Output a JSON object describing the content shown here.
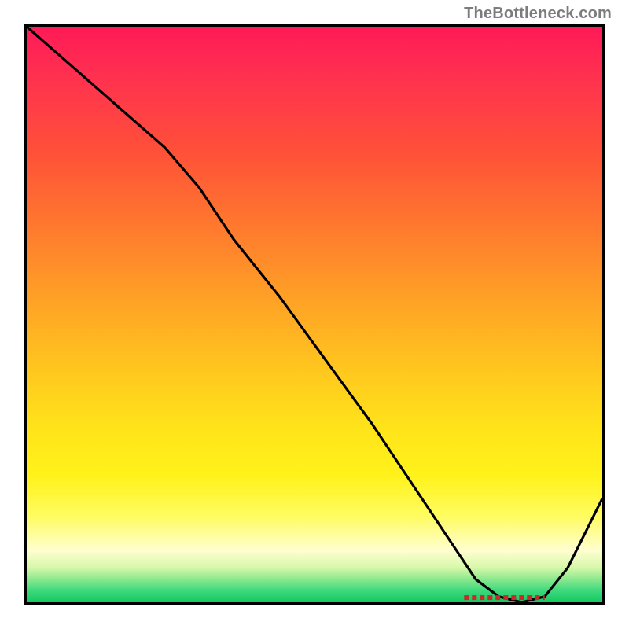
{
  "watermark": "TheBottleneck.com",
  "chart_data": {
    "type": "line",
    "title": "",
    "xlabel": "",
    "ylabel": "",
    "xlim": [
      0,
      100
    ],
    "ylim": [
      0,
      100
    ],
    "grid": false,
    "series": [
      {
        "name": "curve",
        "x": [
          0,
          8,
          16,
          24,
          30,
          36,
          44,
          52,
          60,
          68,
          74,
          78,
          82,
          86,
          90,
          94,
          100
        ],
        "values": [
          100,
          93,
          86,
          79,
          72,
          63,
          53,
          42,
          31,
          19,
          10,
          4,
          1,
          0,
          1,
          6,
          18
        ]
      }
    ],
    "annotations": [
      {
        "name": "valley-marker",
        "type": "segment",
        "x0": 76,
        "x1": 90,
        "y": 0.8,
        "color": "#c9282d",
        "style": "dashed"
      }
    ],
    "background": {
      "type": "vertical-gradient",
      "stops": [
        {
          "pos": 0.0,
          "color": "#ff1a57"
        },
        {
          "pos": 0.22,
          "color": "#ff5138"
        },
        {
          "pos": 0.48,
          "color": "#ffa325"
        },
        {
          "pos": 0.7,
          "color": "#ffe41a"
        },
        {
          "pos": 0.91,
          "color": "#fffed0"
        },
        {
          "pos": 1.0,
          "color": "#14c85f"
        }
      ]
    }
  }
}
